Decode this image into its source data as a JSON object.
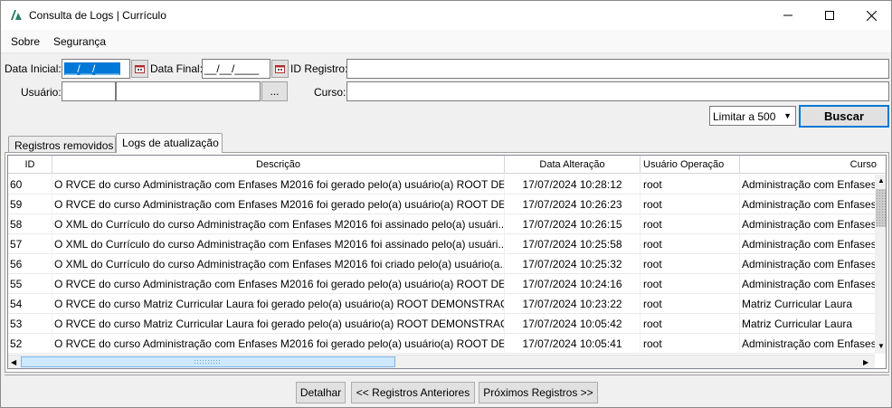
{
  "window": {
    "title": "Consulta de Logs | Currículo",
    "minimize_icon": "minimize-icon",
    "maximize_icon": "maximize-icon",
    "close_icon": "close-icon"
  },
  "menu": {
    "items": [
      {
        "label": "Sobre"
      },
      {
        "label": "Segurança"
      }
    ]
  },
  "form": {
    "data_inicial_label": "Data Inicial:",
    "data_inicial_value": "__/__/____",
    "data_final_label": "Data Final:",
    "data_final_value": "__/__/____",
    "id_registro_label": "ID Registro:",
    "id_registro_value": "",
    "usuario_label": "Usuário:",
    "usuario_id_value": "",
    "usuario_name_value": "",
    "usuario_lookup_label": "...",
    "curso_label": "Curso:",
    "curso_value": "",
    "limit_selected": "Limitar a 500",
    "buscar_label": "Buscar"
  },
  "tabs": [
    {
      "label": "Registros removidos",
      "active": false
    },
    {
      "label": "Logs de atualização",
      "active": true
    }
  ],
  "grid": {
    "columns": [
      "ID",
      "Descrição",
      "Data Alteração",
      "Usuário Operação",
      "Curso"
    ],
    "rows": [
      {
        "id": "60",
        "descricao": "O RVCE do curso Administração com Enfases M2016 foi gerado pelo(a) usuário(a) ROOT DE...",
        "data": "17/07/2024 10:28:12",
        "usuario": "root",
        "curso": "Administração com Enfases"
      },
      {
        "id": "59",
        "descricao": "O RVCE do curso Administração com Enfases M2016 foi gerado pelo(a) usuário(a) ROOT DE...",
        "data": "17/07/2024 10:26:23",
        "usuario": "root",
        "curso": "Administração com Enfases"
      },
      {
        "id": "58",
        "descricao": "O XML do Currículo do curso Administração com Enfases M2016 foi assinado pelo(a) usuári...",
        "data": "17/07/2024 10:26:15",
        "usuario": "root",
        "curso": "Administração com Enfases"
      },
      {
        "id": "57",
        "descricao": "O XML do Currículo do curso Administração com Enfases M2016 foi assinado pelo(a) usuári...",
        "data": "17/07/2024 10:25:58",
        "usuario": "root",
        "curso": "Administração com Enfases"
      },
      {
        "id": "56",
        "descricao": "O XML do Currículo do curso Administração com Enfases M2016 foi criado pelo(a) usuário(a...",
        "data": "17/07/2024 10:25:32",
        "usuario": "root",
        "curso": "Administração com Enfases"
      },
      {
        "id": "55",
        "descricao": "O RVCE do curso Administração com Enfases M2016 foi gerado pelo(a) usuário(a) ROOT DE...",
        "data": "17/07/2024 10:24:16",
        "usuario": "root",
        "curso": "Administração com Enfases"
      },
      {
        "id": "54",
        "descricao": "O RVCE do curso Matriz Curricular Laura foi gerado pelo(a) usuário(a) ROOT DEMONSTRAÇÃ...",
        "data": "17/07/2024 10:23:22",
        "usuario": "root",
        "curso": "Matriz Curricular Laura"
      },
      {
        "id": "53",
        "descricao": "O RVCE do curso Matriz Curricular Laura foi gerado pelo(a) usuário(a) ROOT DEMONSTRAÇÃ...",
        "data": "17/07/2024 10:05:42",
        "usuario": "root",
        "curso": "Matriz Curricular Laura"
      },
      {
        "id": "52",
        "descricao": "O RVCE do curso Administração com Enfases M2016 foi gerado pelo(a) usuário(a) ROOT DE...",
        "data": "17/07/2024 10:05:41",
        "usuario": "root",
        "curso": "Administração com Enfases"
      }
    ]
  },
  "footer": {
    "detalhar_label": "Detalhar",
    "anteriores_label": "<< Registros Anteriores",
    "proximos_label": "Próximos Registros >>"
  },
  "colors": {
    "selection": "#0078d7",
    "window_bg": "#f0f0f0"
  }
}
